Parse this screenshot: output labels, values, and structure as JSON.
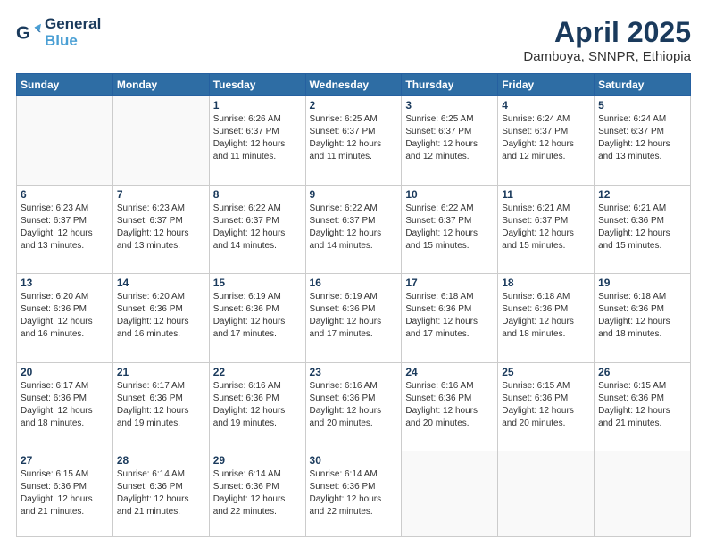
{
  "header": {
    "logo_line1": "General",
    "logo_line2": "Blue",
    "month": "April 2025",
    "location": "Damboya, SNNPR, Ethiopia"
  },
  "days_of_week": [
    "Sunday",
    "Monday",
    "Tuesday",
    "Wednesday",
    "Thursday",
    "Friday",
    "Saturday"
  ],
  "weeks": [
    [
      {
        "day": "",
        "info": ""
      },
      {
        "day": "",
        "info": ""
      },
      {
        "day": "1",
        "info": "Sunrise: 6:26 AM\nSunset: 6:37 PM\nDaylight: 12 hours\nand 11 minutes."
      },
      {
        "day": "2",
        "info": "Sunrise: 6:25 AM\nSunset: 6:37 PM\nDaylight: 12 hours\nand 11 minutes."
      },
      {
        "day": "3",
        "info": "Sunrise: 6:25 AM\nSunset: 6:37 PM\nDaylight: 12 hours\nand 12 minutes."
      },
      {
        "day": "4",
        "info": "Sunrise: 6:24 AM\nSunset: 6:37 PM\nDaylight: 12 hours\nand 12 minutes."
      },
      {
        "day": "5",
        "info": "Sunrise: 6:24 AM\nSunset: 6:37 PM\nDaylight: 12 hours\nand 13 minutes."
      }
    ],
    [
      {
        "day": "6",
        "info": "Sunrise: 6:23 AM\nSunset: 6:37 PM\nDaylight: 12 hours\nand 13 minutes."
      },
      {
        "day": "7",
        "info": "Sunrise: 6:23 AM\nSunset: 6:37 PM\nDaylight: 12 hours\nand 13 minutes."
      },
      {
        "day": "8",
        "info": "Sunrise: 6:22 AM\nSunset: 6:37 PM\nDaylight: 12 hours\nand 14 minutes."
      },
      {
        "day": "9",
        "info": "Sunrise: 6:22 AM\nSunset: 6:37 PM\nDaylight: 12 hours\nand 14 minutes."
      },
      {
        "day": "10",
        "info": "Sunrise: 6:22 AM\nSunset: 6:37 PM\nDaylight: 12 hours\nand 15 minutes."
      },
      {
        "day": "11",
        "info": "Sunrise: 6:21 AM\nSunset: 6:37 PM\nDaylight: 12 hours\nand 15 minutes."
      },
      {
        "day": "12",
        "info": "Sunrise: 6:21 AM\nSunset: 6:36 PM\nDaylight: 12 hours\nand 15 minutes."
      }
    ],
    [
      {
        "day": "13",
        "info": "Sunrise: 6:20 AM\nSunset: 6:36 PM\nDaylight: 12 hours\nand 16 minutes."
      },
      {
        "day": "14",
        "info": "Sunrise: 6:20 AM\nSunset: 6:36 PM\nDaylight: 12 hours\nand 16 minutes."
      },
      {
        "day": "15",
        "info": "Sunrise: 6:19 AM\nSunset: 6:36 PM\nDaylight: 12 hours\nand 17 minutes."
      },
      {
        "day": "16",
        "info": "Sunrise: 6:19 AM\nSunset: 6:36 PM\nDaylight: 12 hours\nand 17 minutes."
      },
      {
        "day": "17",
        "info": "Sunrise: 6:18 AM\nSunset: 6:36 PM\nDaylight: 12 hours\nand 17 minutes."
      },
      {
        "day": "18",
        "info": "Sunrise: 6:18 AM\nSunset: 6:36 PM\nDaylight: 12 hours\nand 18 minutes."
      },
      {
        "day": "19",
        "info": "Sunrise: 6:18 AM\nSunset: 6:36 PM\nDaylight: 12 hours\nand 18 minutes."
      }
    ],
    [
      {
        "day": "20",
        "info": "Sunrise: 6:17 AM\nSunset: 6:36 PM\nDaylight: 12 hours\nand 18 minutes."
      },
      {
        "day": "21",
        "info": "Sunrise: 6:17 AM\nSunset: 6:36 PM\nDaylight: 12 hours\nand 19 minutes."
      },
      {
        "day": "22",
        "info": "Sunrise: 6:16 AM\nSunset: 6:36 PM\nDaylight: 12 hours\nand 19 minutes."
      },
      {
        "day": "23",
        "info": "Sunrise: 6:16 AM\nSunset: 6:36 PM\nDaylight: 12 hours\nand 20 minutes."
      },
      {
        "day": "24",
        "info": "Sunrise: 6:16 AM\nSunset: 6:36 PM\nDaylight: 12 hours\nand 20 minutes."
      },
      {
        "day": "25",
        "info": "Sunrise: 6:15 AM\nSunset: 6:36 PM\nDaylight: 12 hours\nand 20 minutes."
      },
      {
        "day": "26",
        "info": "Sunrise: 6:15 AM\nSunset: 6:36 PM\nDaylight: 12 hours\nand 21 minutes."
      }
    ],
    [
      {
        "day": "27",
        "info": "Sunrise: 6:15 AM\nSunset: 6:36 PM\nDaylight: 12 hours\nand 21 minutes."
      },
      {
        "day": "28",
        "info": "Sunrise: 6:14 AM\nSunset: 6:36 PM\nDaylight: 12 hours\nand 21 minutes."
      },
      {
        "day": "29",
        "info": "Sunrise: 6:14 AM\nSunset: 6:36 PM\nDaylight: 12 hours\nand 22 minutes."
      },
      {
        "day": "30",
        "info": "Sunrise: 6:14 AM\nSunset: 6:36 PM\nDaylight: 12 hours\nand 22 minutes."
      },
      {
        "day": "",
        "info": ""
      },
      {
        "day": "",
        "info": ""
      },
      {
        "day": "",
        "info": ""
      }
    ]
  ]
}
